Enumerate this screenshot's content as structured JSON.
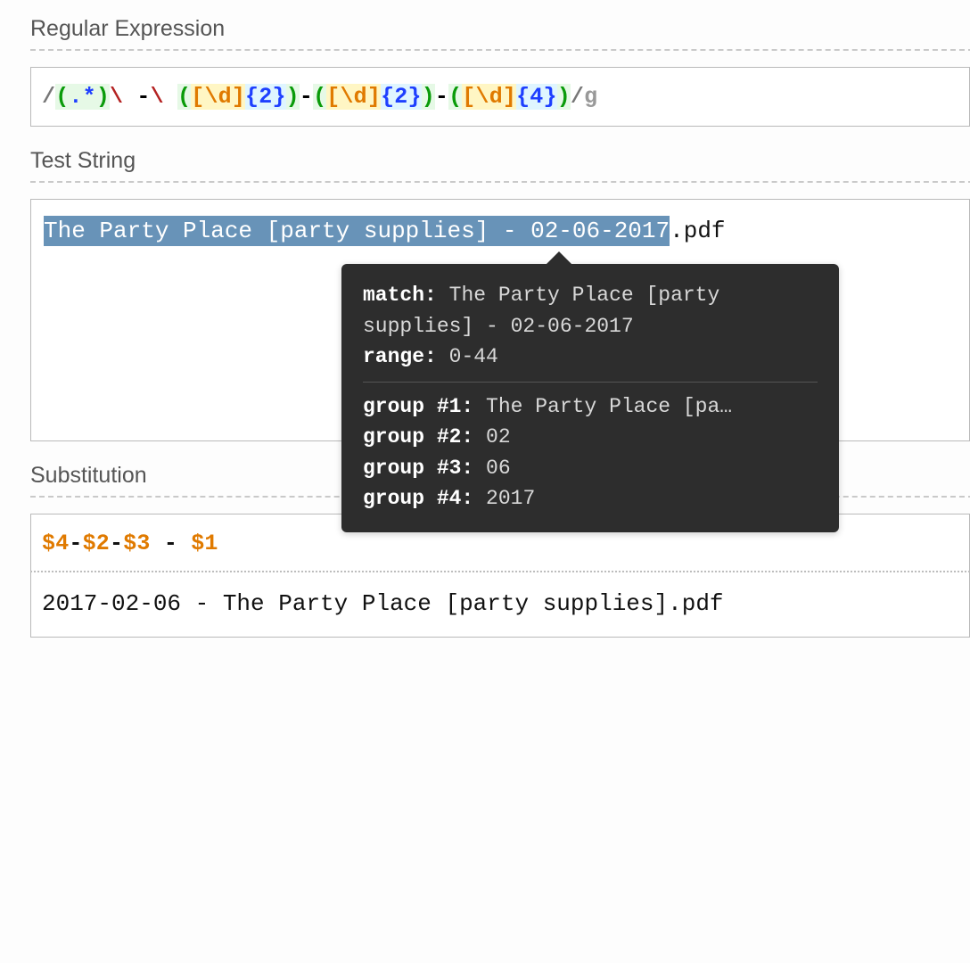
{
  "sections": {
    "regex_label": "Regular Expression",
    "teststring_label": "Test String",
    "substitution_label": "Substitution"
  },
  "regex": {
    "slash_open": "/",
    "group1_open": "(",
    "dot": ".",
    "star": "*",
    "group1_close": ")",
    "esc1": "\\ ",
    "dash1": "-",
    "esc2": "\\ ",
    "g2_open": "(",
    "g2_class_open": "[",
    "g2_d": "\\d",
    "g2_class_close": "]",
    "g2_quant": "{2}",
    "g2_close": ")",
    "mid_dash1": "-",
    "g3_open": "(",
    "g3_class_open": "[",
    "g3_d": "\\d",
    "g3_class_close": "]",
    "g3_quant": "{2}",
    "g3_close": ")",
    "mid_dash2": "-",
    "g4_open": "(",
    "g4_class_open": "[",
    "g4_d": "\\d",
    "g4_class_close": "]",
    "g4_quant": "{4}",
    "g4_close": ")",
    "slash_close": "/",
    "flags": "g"
  },
  "test_string": {
    "matched": "The Party Place [party supplies] - 02-06-2017",
    "unmatched": ".pdf"
  },
  "tooltip": {
    "match_label": "match:",
    "match_value": "The Party Place [party supplies] - 02-06-2017",
    "range_label": "range:",
    "range_value": "0-44",
    "g1_label": "group #1:",
    "g1_value": "The Party Place [pa…",
    "g2_label": "group #2:",
    "g2_value": "02",
    "g3_label": "group #3:",
    "g3_value": "06",
    "g4_label": "group #4:",
    "g4_value": "2017"
  },
  "substitution": {
    "t1": "$4",
    "d1": "-",
    "t2": "$2",
    "d2": "-",
    "t3": "$3",
    "sep": " - ",
    "t4": "$1"
  },
  "output": {
    "result": "2017-02-06 - The Party Place [party supplies].pdf"
  }
}
